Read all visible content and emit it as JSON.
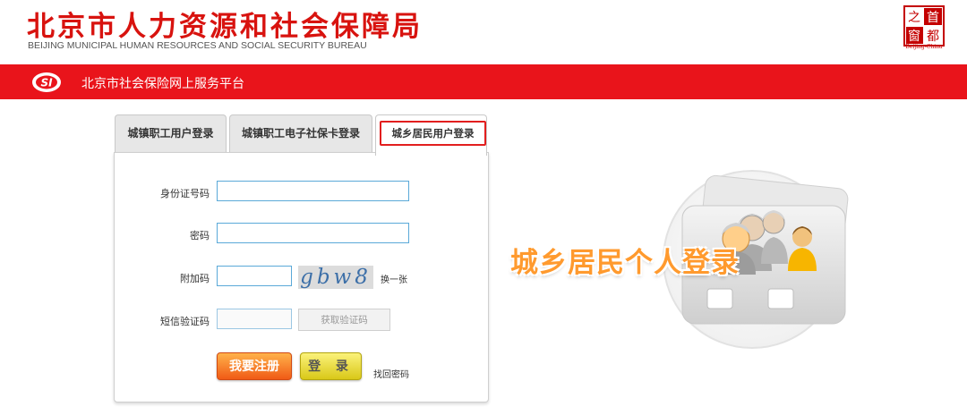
{
  "header": {
    "org_title": "北京市人力资源和社会保障局",
    "org_subtitle": "BEIJING MUNICIPAL HUMAN RESOURCES AND SOCIAL SECURITY BUREAU",
    "seal_chars": [
      "首",
      "都",
      "之",
      "窗"
    ],
    "seal_caption": "Beijing-China"
  },
  "platform": {
    "name": "北京市社会保险网上服务平台"
  },
  "tabs": [
    {
      "label": "城镇职工用户登录",
      "active": false
    },
    {
      "label": "城镇职工电子社保卡登录",
      "active": false
    },
    {
      "label": "城乡居民用户登录",
      "active": true
    }
  ],
  "form": {
    "id_label": "身份证号码",
    "id_value": "",
    "password_label": "密码",
    "password_value": "",
    "captcha_label": "附加码",
    "captcha_value": "",
    "captcha_text": "gbw8",
    "refresh_label": "换一张",
    "sms_label": "短信验证码",
    "sms_value": "",
    "get_sms_button": "获取验证码",
    "register_button": "我要注册",
    "login_button": "登 录",
    "forgot_link": "找回密码"
  },
  "hero": {
    "text": "城乡居民个人登录"
  },
  "colors": {
    "brand_red": "#e9141b",
    "title_red": "#d8130f",
    "hero_orange": "#ff9a2e",
    "input_border": "#5aa9d8"
  }
}
